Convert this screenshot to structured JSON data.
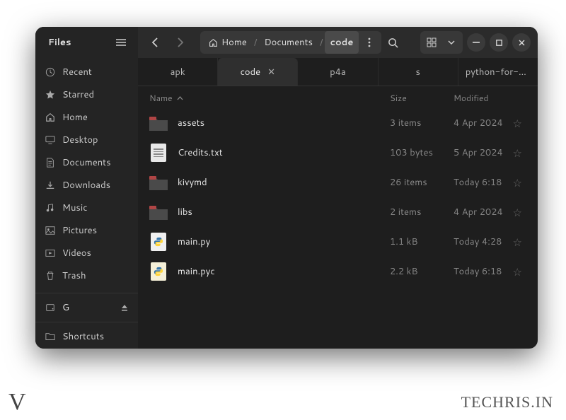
{
  "app": {
    "title": "Files"
  },
  "breadcrumb": [
    {
      "label": "Home",
      "icon": "home"
    },
    {
      "label": "Documents"
    },
    {
      "label": "code",
      "active": true
    }
  ],
  "sidebar": {
    "items": [
      {
        "icon": "clock",
        "label": "Recent"
      },
      {
        "icon": "star",
        "label": "Starred"
      },
      {
        "icon": "home",
        "label": "Home"
      },
      {
        "icon": "desktop",
        "label": "Desktop"
      },
      {
        "icon": "doc",
        "label": "Documents"
      },
      {
        "icon": "download",
        "label": "Downloads"
      },
      {
        "icon": "music",
        "label": "Music"
      },
      {
        "icon": "picture",
        "label": "Pictures"
      },
      {
        "icon": "video",
        "label": "Videos"
      },
      {
        "icon": "trash",
        "label": "Trash"
      }
    ],
    "drive": {
      "label": "G"
    },
    "shortcuts": {
      "label": "Shortcuts"
    }
  },
  "tabs": [
    {
      "label": "apk"
    },
    {
      "label": "code",
      "active": true,
      "closable": true
    },
    {
      "label": "p4a"
    },
    {
      "label": "s"
    },
    {
      "label": "python-for-android"
    }
  ],
  "columns": {
    "name": "Name",
    "size": "Size",
    "modified": "Modified"
  },
  "files": [
    {
      "type": "folder",
      "name": "assets",
      "size": "3 items",
      "modified": "4 Apr 2024"
    },
    {
      "type": "text",
      "name": "Credits.txt",
      "size": "103 bytes",
      "modified": "5 Apr 2024"
    },
    {
      "type": "folder",
      "name": "kivymd",
      "size": "26 items",
      "modified": "Today 6:18"
    },
    {
      "type": "folder",
      "name": "libs",
      "size": "2 items",
      "modified": "4 Apr 2024"
    },
    {
      "type": "python",
      "name": "main.py",
      "size": "1.1 kB",
      "modified": "Today 4:28"
    },
    {
      "type": "pythonc",
      "name": "main.pyc",
      "size": "2.2 kB",
      "modified": "Today 6:18"
    }
  ],
  "watermark": {
    "logo": "V",
    "brand": "TECHRIS.IN"
  }
}
